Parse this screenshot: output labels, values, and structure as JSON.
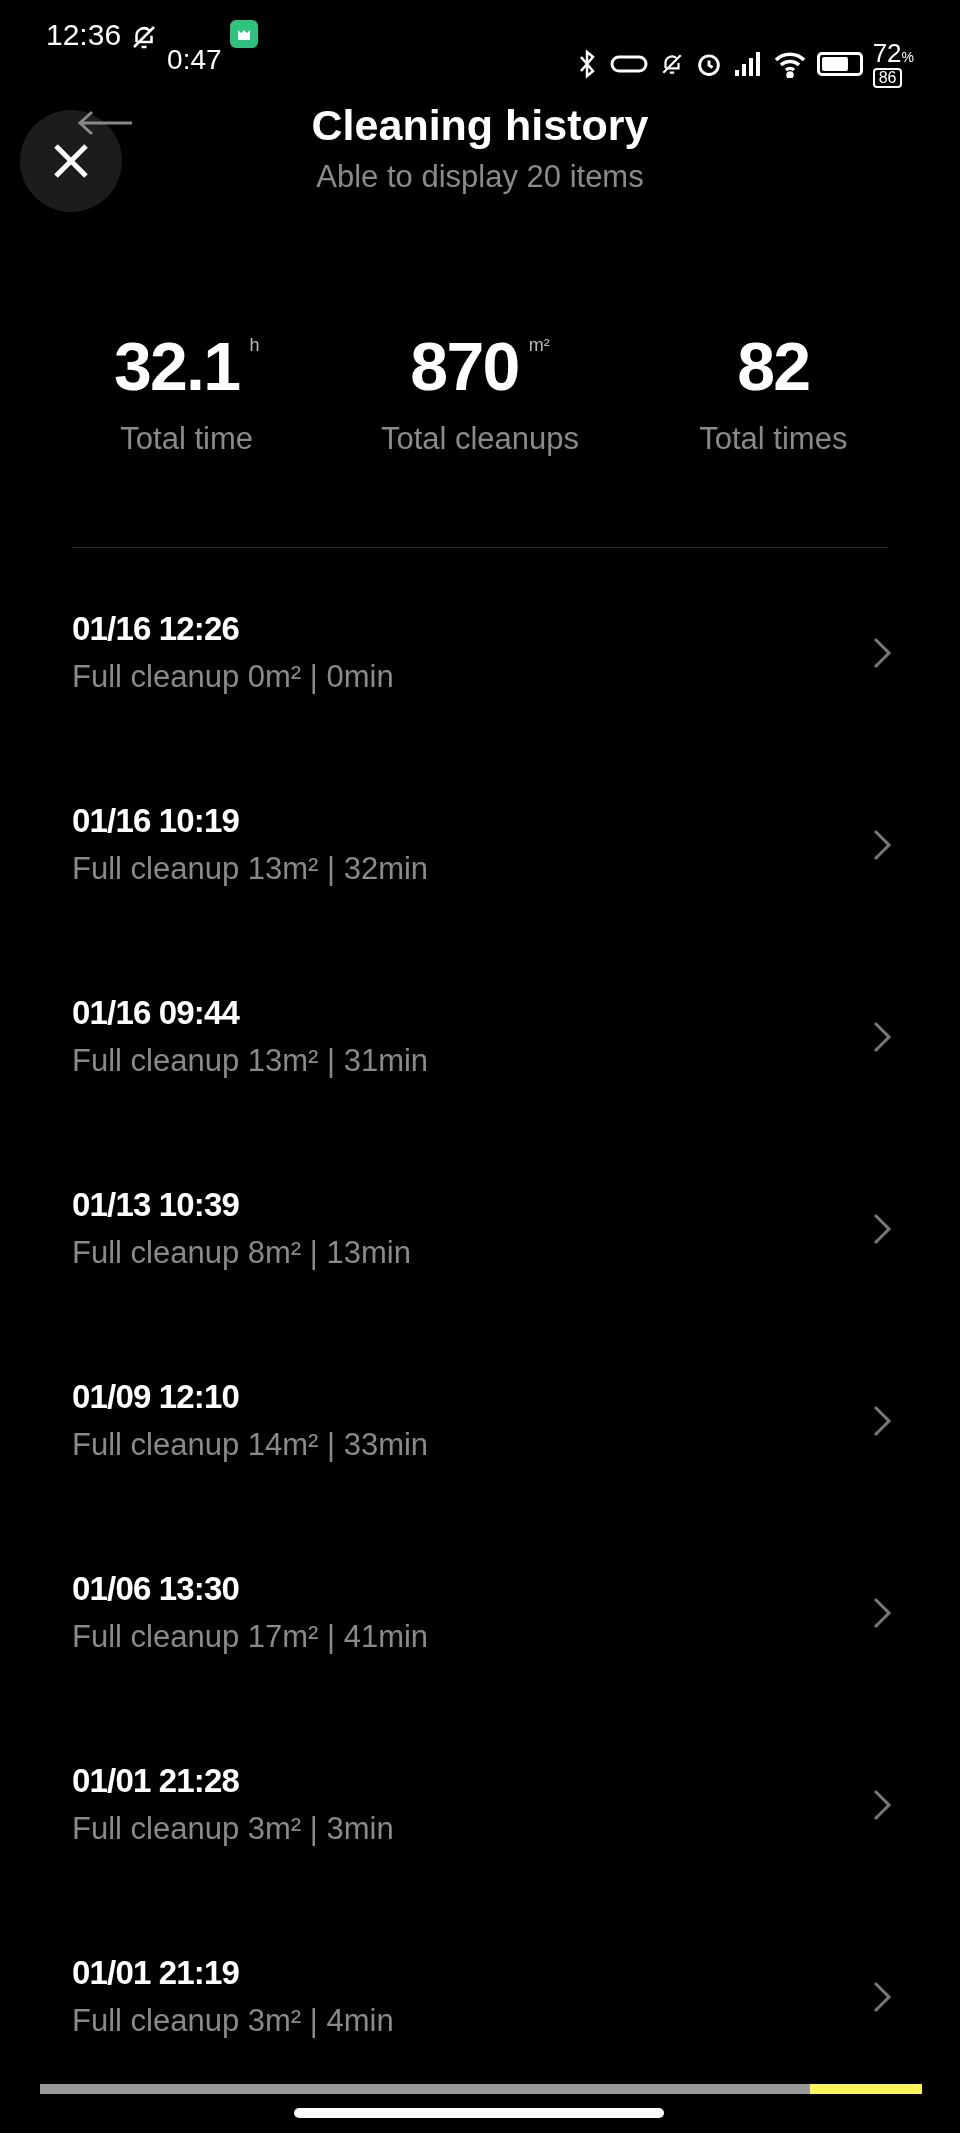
{
  "status_bar": {
    "time": "12:36",
    "timer": "0:47",
    "battery": "72",
    "battery_unit": "%",
    "battery_small": "86"
  },
  "header": {
    "title": "Cleaning history",
    "subtitle": "Able to display 20 items"
  },
  "stats": [
    {
      "value": "32.1",
      "unit": "h",
      "label": "Total time"
    },
    {
      "value": "870",
      "unit": "m²",
      "label": "Total cleanups"
    },
    {
      "value": "82",
      "label": "Total times"
    }
  ],
  "records": [
    {
      "datetime": "01/16 12:26",
      "summary": "Full cleanup 0m² | 0min"
    },
    {
      "datetime": "01/16 10:19",
      "summary": "Full cleanup 13m² | 32min"
    },
    {
      "datetime": "01/16 09:44",
      "summary": "Full cleanup 13m² | 31min"
    },
    {
      "datetime": "01/13 10:39",
      "summary": "Full cleanup 8m² | 13min"
    },
    {
      "datetime": "01/09 12:10",
      "summary": "Full cleanup 14m² | 33min"
    },
    {
      "datetime": "01/06 13:30",
      "summary": "Full cleanup 17m² | 41min"
    },
    {
      "datetime": "01/01 21:28",
      "summary": "Full cleanup 3m² | 3min"
    },
    {
      "datetime": "01/01 21:19",
      "summary": "Full cleanup 3m² | 4min"
    }
  ],
  "progress": {
    "level": 0.873
  }
}
